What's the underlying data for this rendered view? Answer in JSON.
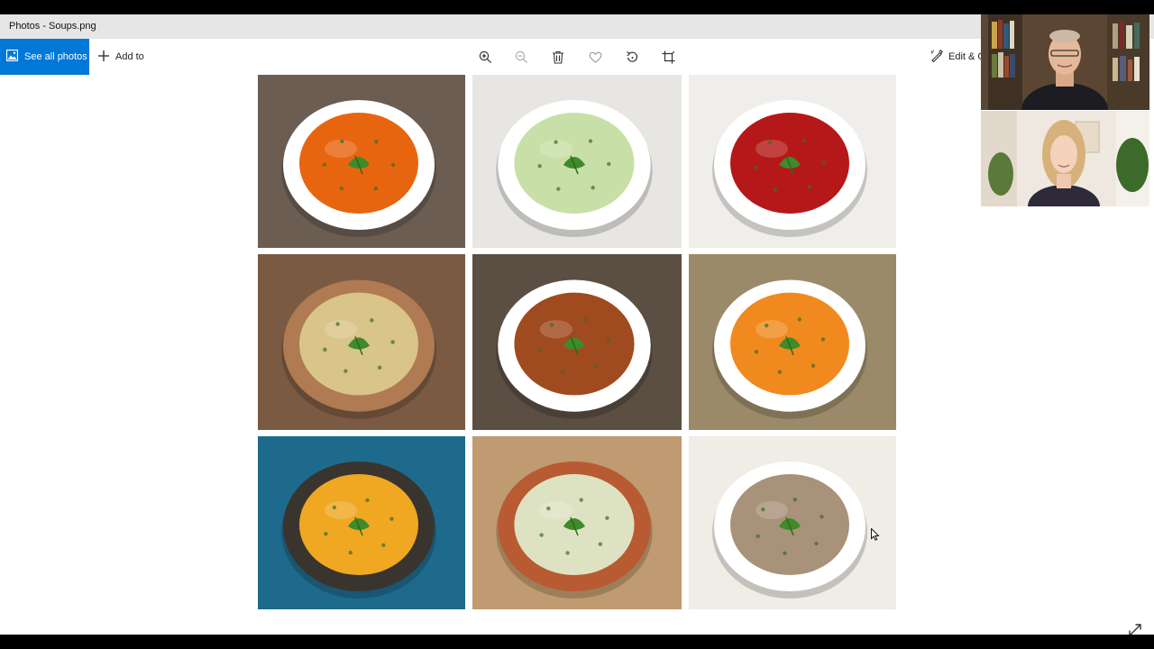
{
  "window": {
    "title": "Photos - Soups.png"
  },
  "toolbar": {
    "see_all_label": "See all photos",
    "add_to_label": "Add to",
    "edit_label": "Edit & C"
  },
  "tools": [
    "zoom-in-icon",
    "zoom-out-icon",
    "delete-icon",
    "favorite-icon",
    "rotate-icon",
    "crop-icon"
  ],
  "soups": [
    {
      "name": "tomato-soup",
      "bowl": "#ffffff",
      "soup": "#e8650f",
      "bg": "#6b5d52"
    },
    {
      "name": "cucumber-soup",
      "bowl": "#ffffff",
      "soup": "#c8e0a8",
      "bg": "#e8e6e2"
    },
    {
      "name": "borscht-soup",
      "bowl": "#ffffff",
      "soup": "#b51818",
      "bg": "#f0eeeb"
    },
    {
      "name": "onion-soup",
      "bowl": "#b07a52",
      "soup": "#d9c48a",
      "bg": "#7a5a42"
    },
    {
      "name": "bean-soup",
      "bowl": "#ffffff",
      "soup": "#a04a20",
      "bg": "#5b4e42"
    },
    {
      "name": "cabbage-soup",
      "bowl": "#ffffff",
      "soup": "#f08a1e",
      "bg": "#9a8a6a"
    },
    {
      "name": "pumpkin-soup",
      "bowl": "#3a342e",
      "soup": "#f0a822",
      "bg": "#1e6a8c"
    },
    {
      "name": "cauliflower-soup",
      "bowl": "#b85a32",
      "soup": "#dde3c2",
      "bg": "#c09a70"
    },
    {
      "name": "mushroom-soup",
      "bowl": "#ffffff",
      "soup": "#a8927a",
      "bg": "#f0ece6"
    }
  ]
}
